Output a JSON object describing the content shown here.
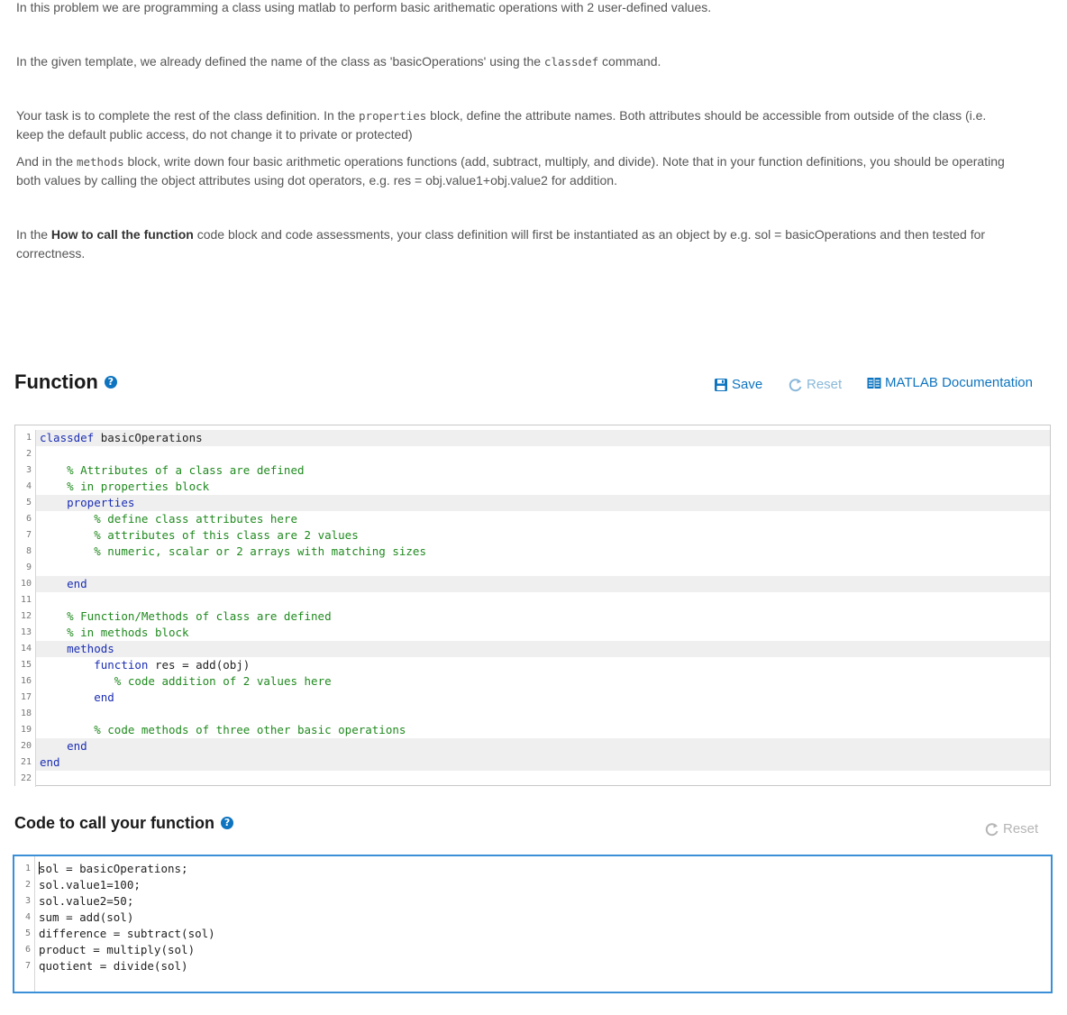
{
  "intro": {
    "p1": "In this problem we are programming a class using matlab to perform basic arithematic operations with 2 user-defined values.",
    "p2_a": "In the given template, we already defined the name of the class as 'basicOperations' using the ",
    "p2_code": "classdef",
    "p2_b": " command.",
    "p3_a": "Your task is to complete the rest of the class definition. In the ",
    "p3_code": "properties",
    "p3_b": " block, define the attribute names. Both attributes should be accessible from outside of the class (i.e. keep the default public access, do not change it to private or protected)",
    "p4_a": "And in the ",
    "p4_code": "methods",
    "p4_b": " block, write down four basic arithmetic operations functions (add, subtract, multiply, and divide). Note that in your function definitions, you should be operating both values by calling the object attributes using dot operators, e.g. res = obj.value1+obj.value2 for addition.",
    "p5_a": "In the ",
    "p5_bold": "How to call the function",
    "p5_b": " code block and code assessments, your class definition will first be instantiated as an object by e.g.  sol = basicOperations and then tested for correctness."
  },
  "function_section": {
    "title": "Function",
    "help_icon": "?",
    "save_label": "Save",
    "reset_label": "Reset",
    "docs_label": "MATLAB Documentation"
  },
  "function_code": [
    {
      "num": "1",
      "parts": [
        {
          "t": "kw",
          "v": "classdef"
        },
        {
          "t": "tx",
          "v": " basicOperations"
        }
      ],
      "hl": true
    },
    {
      "num": "2",
      "parts": [],
      "hl": false
    },
    {
      "num": "3",
      "parts": [
        {
          "t": "tx",
          "v": "    "
        },
        {
          "t": "cm",
          "v": "% Attributes of a class are defined"
        }
      ],
      "hl": false
    },
    {
      "num": "4",
      "parts": [
        {
          "t": "tx",
          "v": "    "
        },
        {
          "t": "cm",
          "v": "% in properties block"
        }
      ],
      "hl": false
    },
    {
      "num": "5",
      "parts": [
        {
          "t": "tx",
          "v": "    "
        },
        {
          "t": "kw",
          "v": "properties"
        }
      ],
      "hl": true
    },
    {
      "num": "6",
      "parts": [
        {
          "t": "tx",
          "v": "        "
        },
        {
          "t": "cm",
          "v": "% define class attributes here"
        }
      ],
      "hl": false
    },
    {
      "num": "7",
      "parts": [
        {
          "t": "tx",
          "v": "        "
        },
        {
          "t": "cm",
          "v": "% attributes of this class are 2 values"
        }
      ],
      "hl": false
    },
    {
      "num": "8",
      "parts": [
        {
          "t": "tx",
          "v": "        "
        },
        {
          "t": "cm",
          "v": "% numeric, scalar or 2 arrays with matching sizes"
        }
      ],
      "hl": false
    },
    {
      "num": "9",
      "parts": [],
      "hl": false
    },
    {
      "num": "10",
      "parts": [
        {
          "t": "tx",
          "v": "    "
        },
        {
          "t": "kw",
          "v": "end"
        }
      ],
      "hl": true
    },
    {
      "num": "11",
      "parts": [],
      "hl": false
    },
    {
      "num": "12",
      "parts": [
        {
          "t": "tx",
          "v": "    "
        },
        {
          "t": "cm",
          "v": "% Function/Methods of class are defined"
        }
      ],
      "hl": false
    },
    {
      "num": "13",
      "parts": [
        {
          "t": "tx",
          "v": "    "
        },
        {
          "t": "cm",
          "v": "% in methods block"
        }
      ],
      "hl": false
    },
    {
      "num": "14",
      "parts": [
        {
          "t": "tx",
          "v": "    "
        },
        {
          "t": "kw",
          "v": "methods"
        }
      ],
      "hl": true
    },
    {
      "num": "15",
      "parts": [
        {
          "t": "tx",
          "v": "        "
        },
        {
          "t": "kw",
          "v": "function"
        },
        {
          "t": "tx",
          "v": " res = add(obj)"
        }
      ],
      "hl": false
    },
    {
      "num": "16",
      "parts": [
        {
          "t": "tx",
          "v": "           "
        },
        {
          "t": "cm",
          "v": "% code addition of 2 values here"
        }
      ],
      "hl": false
    },
    {
      "num": "17",
      "parts": [
        {
          "t": "tx",
          "v": "        "
        },
        {
          "t": "kw",
          "v": "end"
        }
      ],
      "hl": false
    },
    {
      "num": "18",
      "parts": [],
      "hl": false
    },
    {
      "num": "19",
      "parts": [
        {
          "t": "tx",
          "v": "        "
        },
        {
          "t": "cm",
          "v": "% code methods of three other basic operations"
        }
      ],
      "hl": false
    },
    {
      "num": "20",
      "parts": [
        {
          "t": "tx",
          "v": "    "
        },
        {
          "t": "kw",
          "v": "end"
        }
      ],
      "hl": true
    },
    {
      "num": "21",
      "parts": [
        {
          "t": "kw",
          "v": "end"
        }
      ],
      "hl": true
    },
    {
      "num": "22",
      "parts": [],
      "hl": false
    }
  ],
  "call_section": {
    "title": "Code to call your function",
    "help_icon": "?",
    "reset_label": "Reset"
  },
  "call_code": [
    {
      "num": "1",
      "parts": [
        {
          "t": "tx",
          "v": "sol = basicOperations;"
        }
      ]
    },
    {
      "num": "2",
      "parts": [
        {
          "t": "tx",
          "v": "sol.value1=100;"
        }
      ]
    },
    {
      "num": "3",
      "parts": [
        {
          "t": "tx",
          "v": "sol.value2=50;"
        }
      ]
    },
    {
      "num": "4",
      "parts": [
        {
          "t": "tx",
          "v": "sum = add(sol)"
        }
      ]
    },
    {
      "num": "5",
      "parts": [
        {
          "t": "tx",
          "v": "difference = subtract(sol)"
        }
      ]
    },
    {
      "num": "6",
      "parts": [
        {
          "t": "tx",
          "v": "product = multiply(sol)"
        }
      ]
    },
    {
      "num": "7",
      "parts": [
        {
          "t": "tx",
          "v": "quotient = divide(sol)"
        }
      ]
    }
  ],
  "colors": {
    "link": "#0e74bf",
    "reset_disabled": "#8ab8d9",
    "keyword": "#1b2eb4",
    "comment": "#208a1f",
    "focus_border": "#3a8fd6"
  },
  "icons": {
    "save": "floppy-disk-icon",
    "reset": "refresh-icon",
    "docs": "book-icon",
    "help": "question-circle-icon"
  }
}
